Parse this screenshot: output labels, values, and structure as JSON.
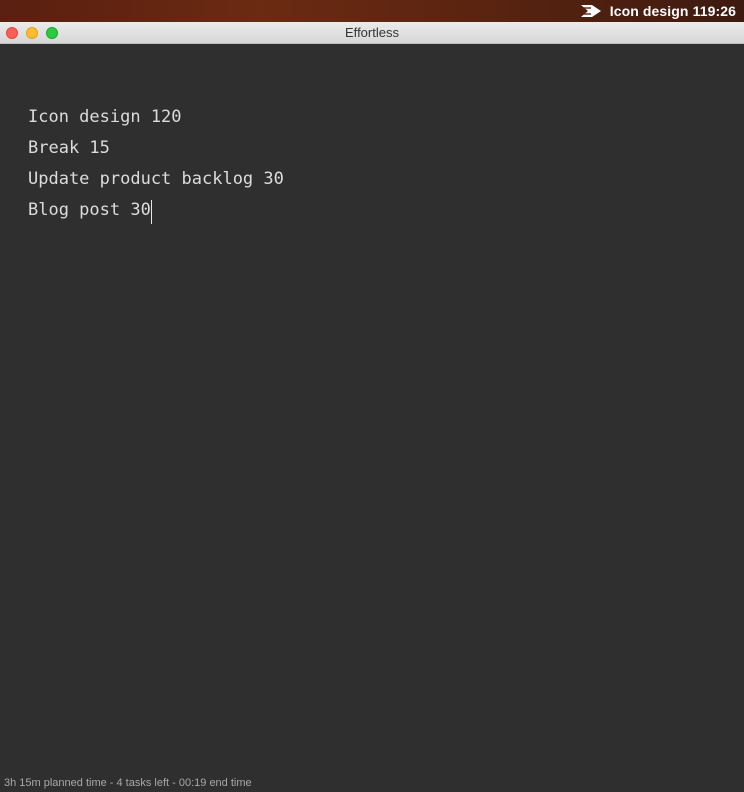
{
  "menubar": {
    "app_icon": "effortless-arrow-icon",
    "status_text": "Icon design 119:26"
  },
  "window": {
    "title": "Effortless"
  },
  "editor": {
    "lines": [
      "Icon design 120",
      "Break 15",
      "Update product backlog 30",
      "Blog post 30"
    ]
  },
  "footer": {
    "summary": "3h 15m planned time - 4 tasks left - 00:19 end time"
  },
  "colors": {
    "editor_bg": "#2f2f2f",
    "text": "#dcdcdc",
    "close": "#fc5f57",
    "minimize": "#fdbb2e",
    "maximize": "#29c940"
  }
}
